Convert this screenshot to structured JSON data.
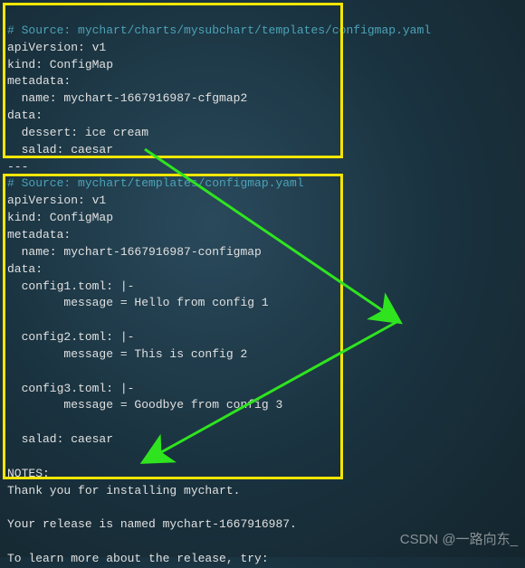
{
  "block1": {
    "comment": "# Source: mychart/charts/mysubchart/templates/configmap.yaml",
    "l1": "apiVersion: v1",
    "l2": "kind: ConfigMap",
    "l3": "metadata:",
    "l4": "  name: mychart-1667916987-cfgmap2",
    "l5": "data:",
    "l6": "  dessert: ice cream",
    "l7": "  salad: caesar"
  },
  "sep": "---",
  "block2": {
    "comment": "# Source: mychart/templates/configmap.yaml",
    "l1": "apiVersion: v1",
    "l2": "kind: ConfigMap",
    "l3": "metadata:",
    "l4": "  name: mychart-1667916987-configmap",
    "l5": "data:",
    "l6": "  config1.toml: |-",
    "l7": "        message = Hello from config 1",
    "l8": "",
    "l9": "  config2.toml: |-",
    "l10": "        message = This is config 2",
    "l11": "",
    "l12": "  config3.toml: |-",
    "l13": "        message = Goodbye from config 3",
    "l14": "",
    "l15": "  salad: caesar"
  },
  "notes": {
    "l1": "NOTES:",
    "l2": "Thank you for installing mychart.",
    "l3": "",
    "l4": "Your release is named mychart-1667916987.",
    "l5": "",
    "l6": "To learn more about the release, try:"
  },
  "watermark": "CSDN @一路向东_"
}
